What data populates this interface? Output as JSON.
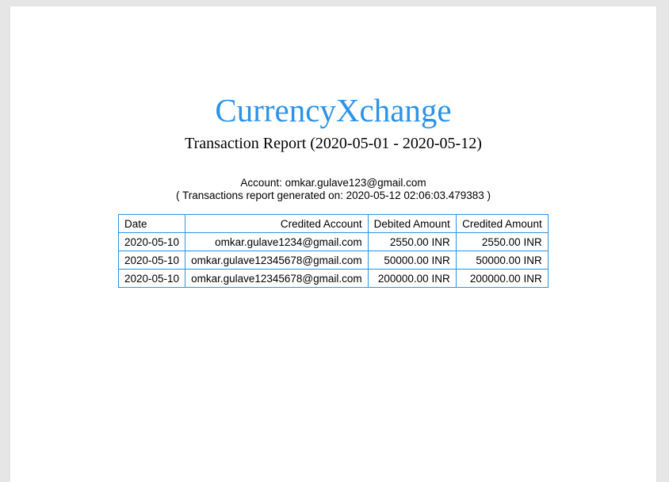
{
  "brand": "CurrencyXchange",
  "report_title": "Transaction Report (2020-05-01 - 2020-05-12)",
  "account_line": "Account: omkar.gulave123@gmail.com",
  "generated_line": "( Transactions report generated on: 2020-05-12 02:06:03.479383 )",
  "table": {
    "headers": {
      "date": "Date",
      "credited_account": "Credited Account",
      "debited_amount": "Debited Amount",
      "credited_amount": "Credited Amount"
    },
    "rows": [
      {
        "date": "2020-05-10",
        "credited_account": "omkar.gulave1234@gmail.com",
        "debited_amount": "2550.00 INR",
        "credited_amount": "2550.00 INR"
      },
      {
        "date": "2020-05-10",
        "credited_account": "omkar.gulave12345678@gmail.com",
        "debited_amount": "50000.00 INR",
        "credited_amount": "50000.00 INR"
      },
      {
        "date": "2020-05-10",
        "credited_account": "omkar.gulave12345678@gmail.com",
        "debited_amount": "200000.00 INR",
        "credited_amount": "200000.00 INR"
      }
    ]
  },
  "colors": {
    "accent": "#2b92e8",
    "page_background": "#ffffff",
    "viewer_background": "#e6e6e6"
  }
}
